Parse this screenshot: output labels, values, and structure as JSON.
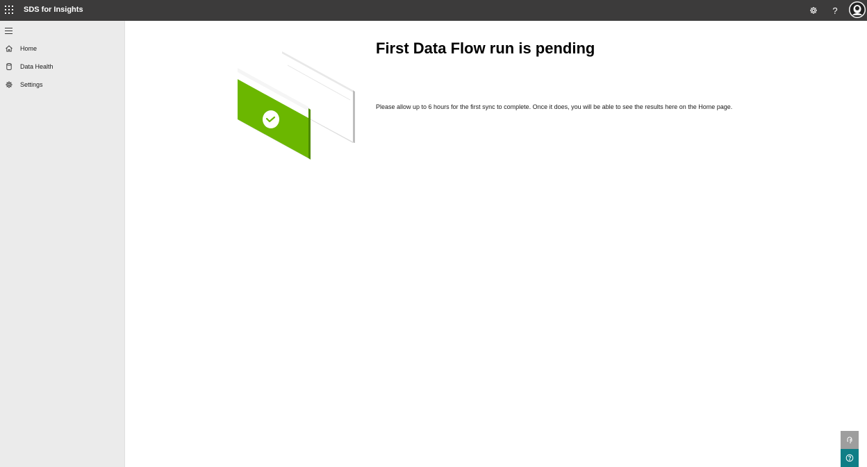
{
  "app": {
    "title": "SDS for Insights"
  },
  "topbar": {
    "icons": [
      "waffle-icon",
      "gear-icon",
      "help-icon",
      "avatar"
    ],
    "help_glyph": "?"
  },
  "sidebar": {
    "items": [
      {
        "label": "Home",
        "icon": "home-icon"
      },
      {
        "label": "Data Health",
        "icon": "database-icon"
      },
      {
        "label": "Settings",
        "icon": "gear-icon"
      }
    ]
  },
  "main": {
    "heading": "First Data Flow run is pending",
    "message": "Please allow up to 6 hours for the first sync to complete. Once it does, you will be able to see the results here on the Home page."
  },
  "floating": {
    "feedback_icon": "feedback-icon",
    "help_icon": "help-circle-icon"
  },
  "colors": {
    "topbar": "#3c3b3b",
    "sidebar": "#ebebeb",
    "accent_green": "#6bb700",
    "help_button": "#0f7e86",
    "feedback_button": "#9e9e9e"
  }
}
